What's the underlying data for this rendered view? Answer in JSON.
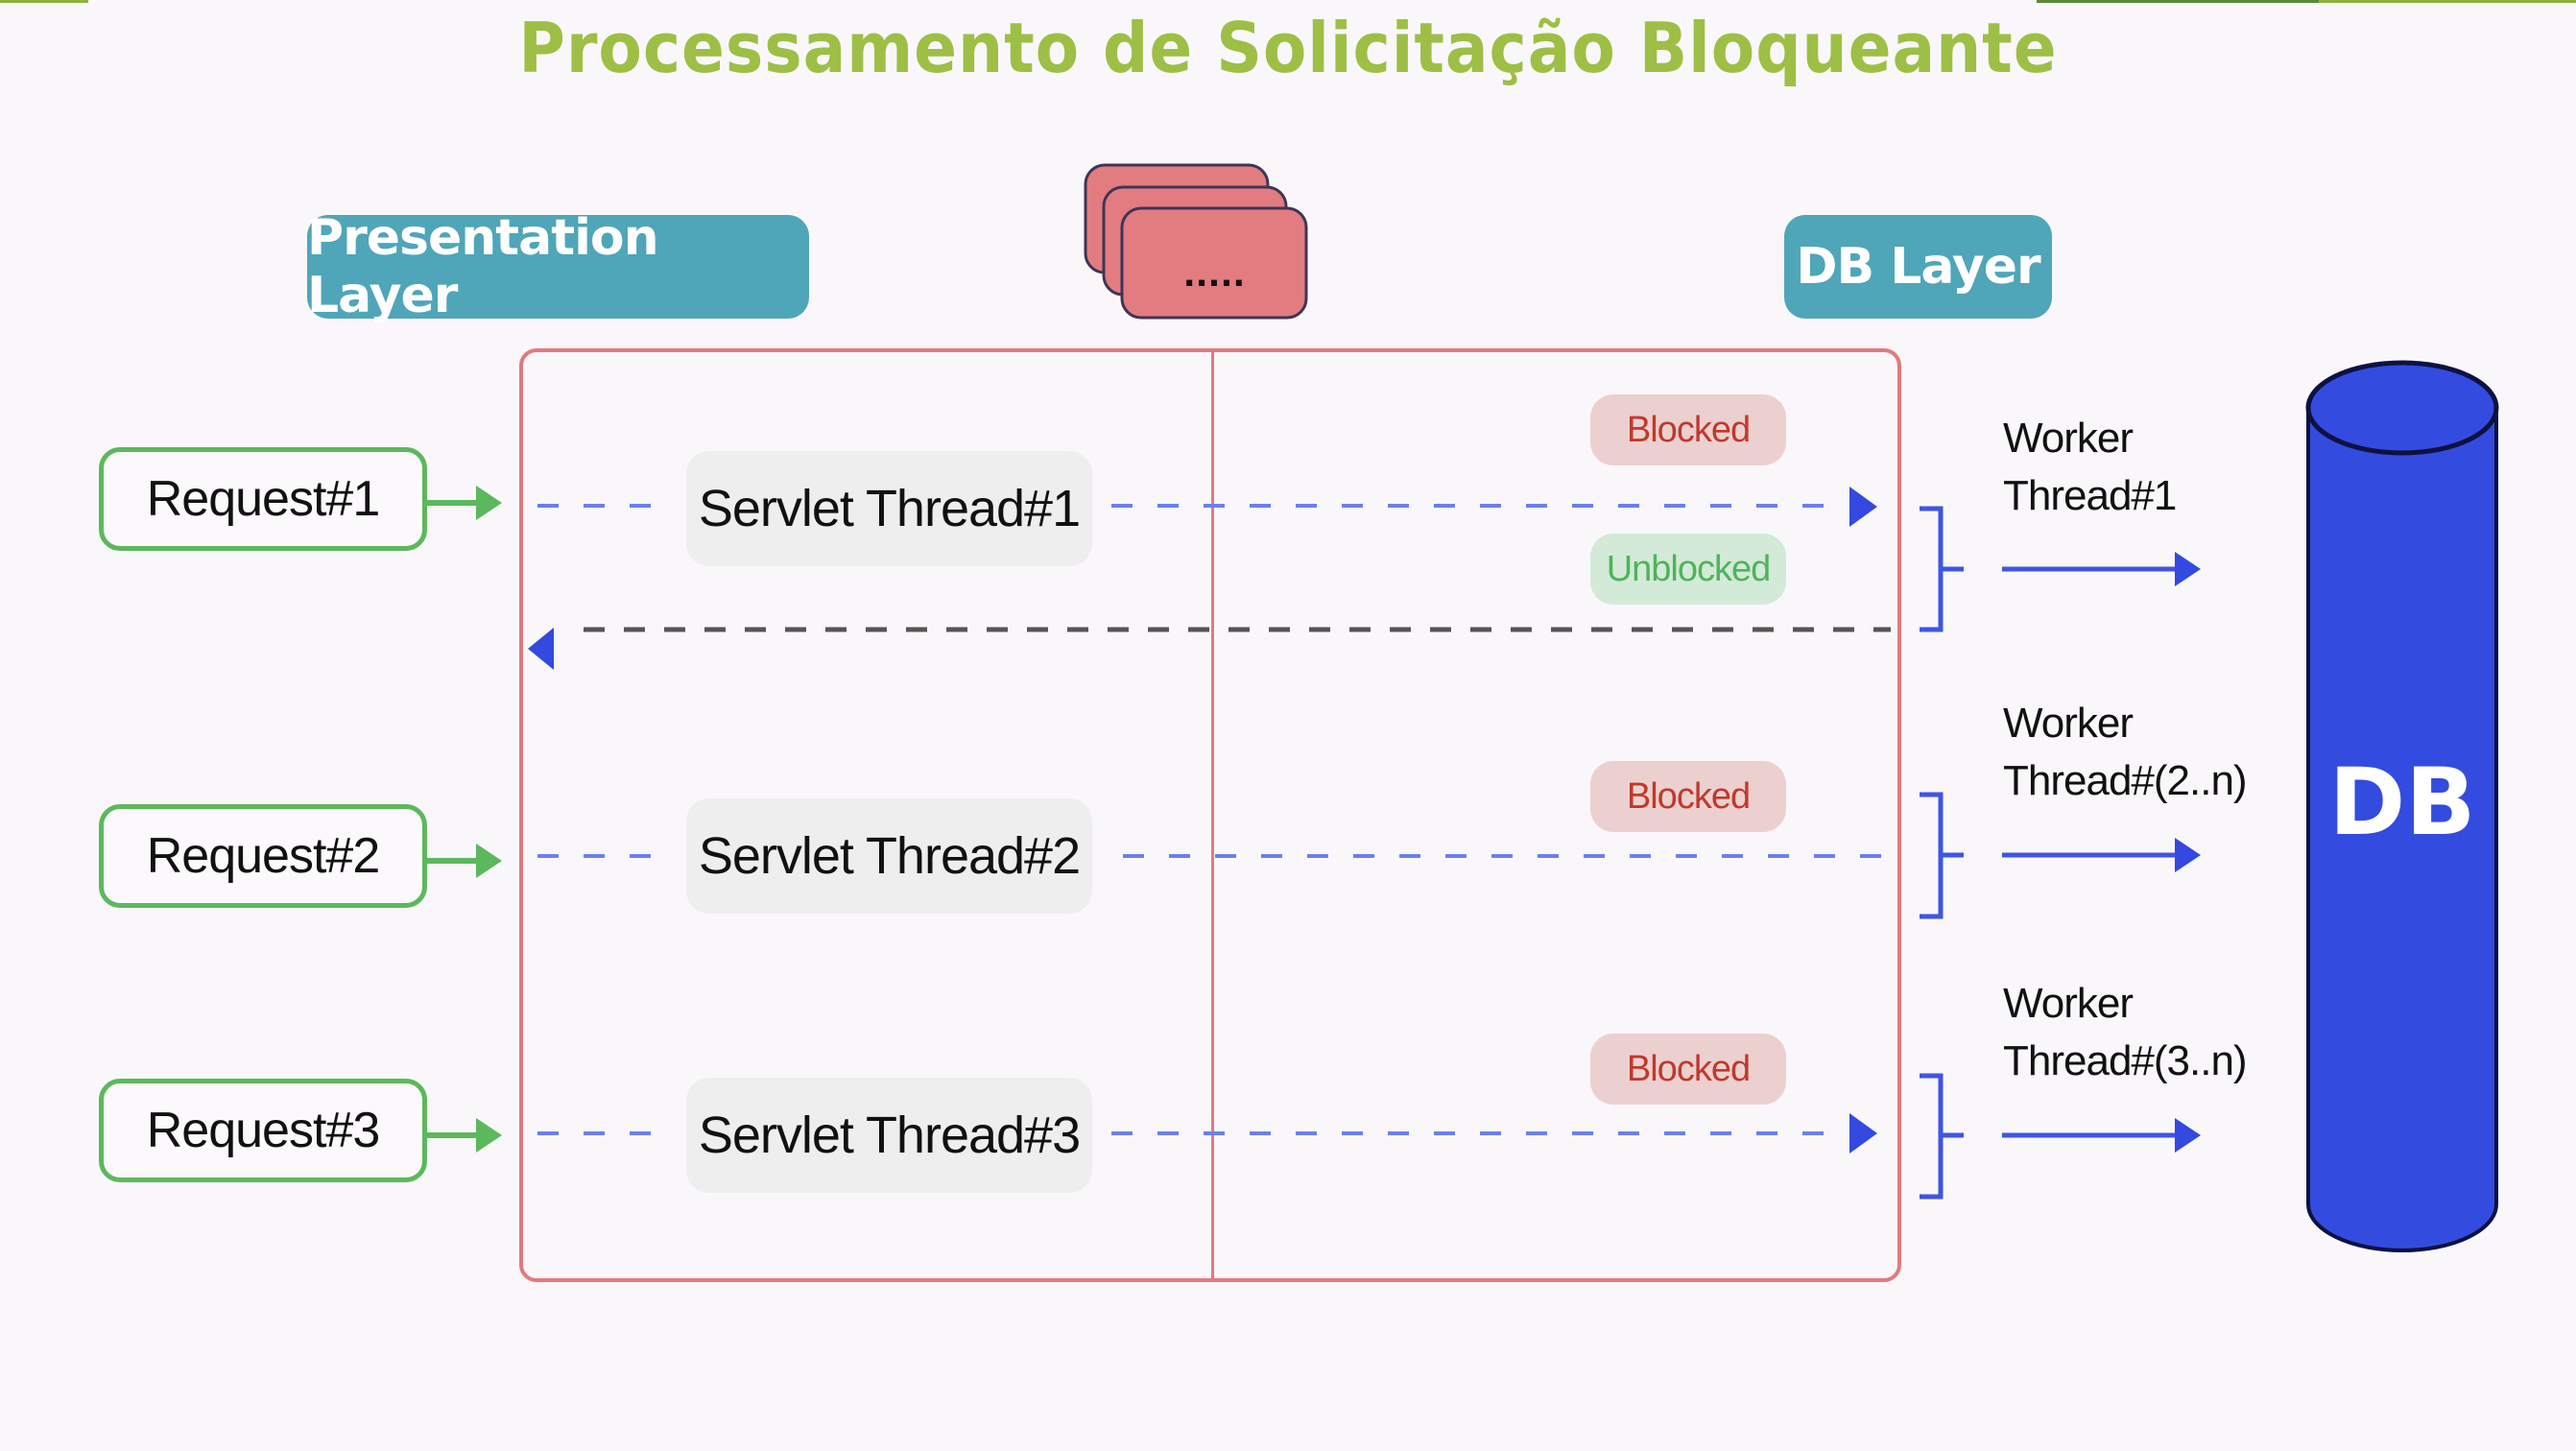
{
  "title": "Processamento de Solicitação Bloqueante",
  "colors": {
    "title": "#9dbf45",
    "layer_badge": "#4fa6b8",
    "container_border": "#e27a7d",
    "request_border": "#5cb85c",
    "request_arrow": "#5cb85c",
    "flow_line": "#6b7ff0",
    "flow_arrow": "#3349e0",
    "return_line": "#555555",
    "blocked_bg": "#ecd0cf",
    "blocked_text": "#c0392b",
    "unblocked_bg": "#d2ead7",
    "unblocked_text": "#4fb35a",
    "db_fill": "#344be0",
    "thread_pool_fill": "#e27c80"
  },
  "layers": {
    "presentation": "Presentation Layer",
    "db": "DB Layer"
  },
  "thread_pool": {
    "label": ".....",
    "icon": "stacked-cards-icon"
  },
  "requests": [
    {
      "label": "Request#1",
      "servlet": "Servlet Thread#1"
    },
    {
      "label": "Request#2",
      "servlet": "Servlet Thread#2"
    },
    {
      "label": "Request#3",
      "servlet": "Servlet Thread#3"
    }
  ],
  "statuses": {
    "blocked_1": "Blocked",
    "unblocked_1": "Unblocked",
    "blocked_2": "Blocked",
    "blocked_3": "Blocked"
  },
  "workers": [
    {
      "line1": "Worker",
      "line2": "Thread#1"
    },
    {
      "line1": "Worker",
      "line2": "Thread#(2..n)"
    },
    {
      "line1": "Worker",
      "line2": "Thread#(3..n)"
    }
  ],
  "database": {
    "label": "DB",
    "icon": "database-cylinder-icon"
  }
}
